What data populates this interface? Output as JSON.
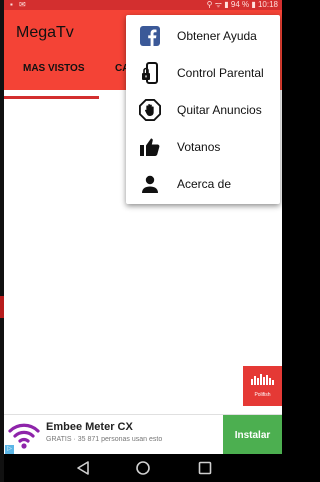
{
  "status_bar": {
    "left_icons": "▪ ✉",
    "right_text": "⚲ ᯤ ▮ 94 % ▮ 10:18"
  },
  "app": {
    "title": "MegaTv",
    "tabs": [
      {
        "label": "MAS VISTOS"
      },
      {
        "label": "CA"
      }
    ],
    "accent_color": "#f44336"
  },
  "menu": {
    "items": [
      {
        "label": "Obtener Ayuda",
        "icon": "facebook-icon"
      },
      {
        "label": "Control Parental",
        "icon": "phone-lock-icon"
      },
      {
        "label": "Quitar Anuncios",
        "icon": "stop-hand-icon"
      },
      {
        "label": "Votanos",
        "icon": "thumbs-up-icon"
      },
      {
        "label": "Acerca de",
        "icon": "person-icon"
      }
    ]
  },
  "polifish": {
    "label": "Polifish"
  },
  "ad": {
    "title": "Embee Meter CX",
    "subtitle": "GRATIS · 35 871 personas usan esto",
    "install_label": "Instalar",
    "info_glyph": "▷",
    "install_color": "#4caf50"
  }
}
